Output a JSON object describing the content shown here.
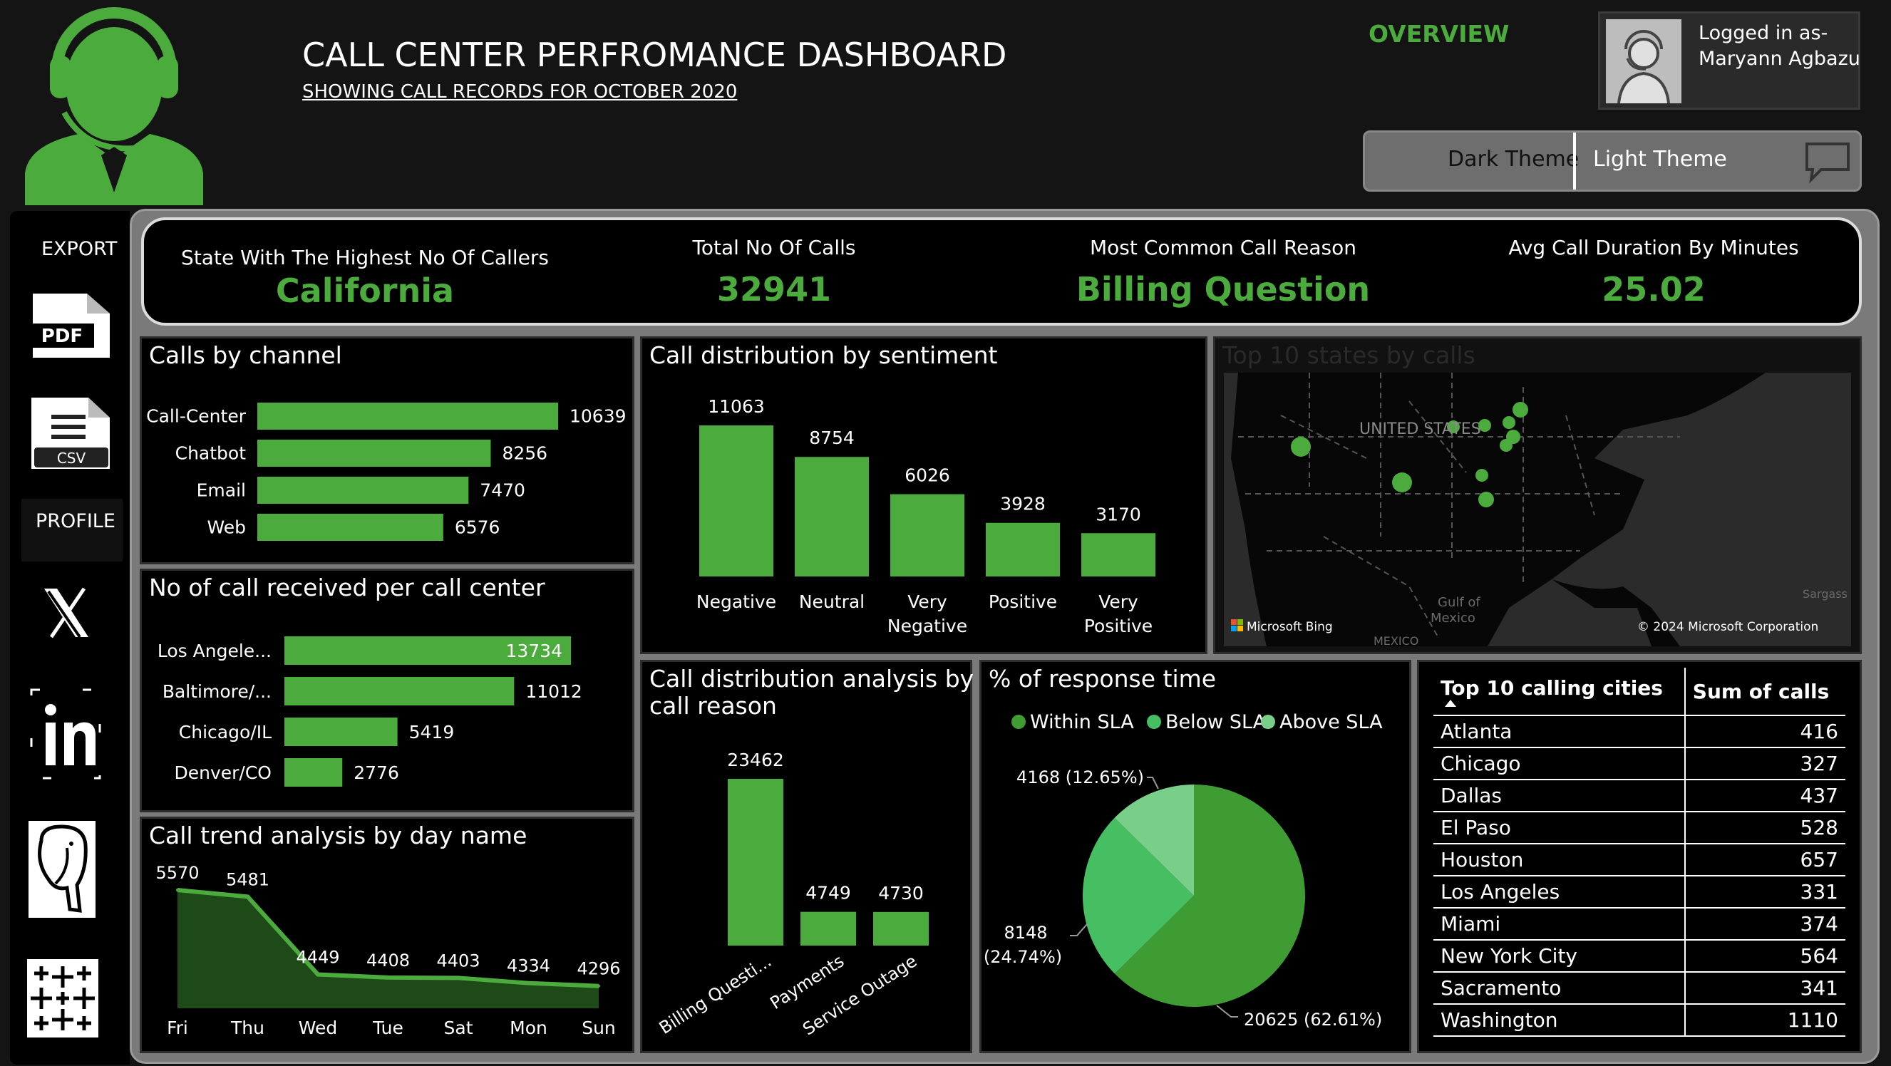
{
  "header": {
    "title": "CALL CENTER PERFROMANCE DASHBOARD",
    "subtitle": "SHOWING CALL RECORDS FOR OCTOBER 2020",
    "nav_overview": "OVERVIEW",
    "user_line1": "Logged in as-",
    "user_line2": "Maryann  Agbazu",
    "theme_dark": "Dark Theme",
    "theme_light": "Light Theme"
  },
  "sidebar": {
    "export_label": "EXPORT",
    "pdf_label": "PDF",
    "csv_label": "CSV",
    "profile_label": "PROFILE"
  },
  "kpis": {
    "state_label": "State With The Highest No Of Callers",
    "state_value": "California",
    "calls_label": "Total No Of Calls",
    "calls_value": "32941",
    "reason_label": "Most Common Call Reason",
    "reason_value": "Billing Question",
    "duration_label": "Avg Call Duration By Minutes",
    "duration_value": "25.02"
  },
  "panels": {
    "channel_title": "Calls by channel",
    "center_title": "No of call received per call center",
    "trend_title": "Call trend analysis by day name",
    "sentiment_title": "Call distribution by sentiment",
    "reason_title_1": "Call distribution analysis by",
    "reason_title_2": "call reason",
    "response_title": "% of response time",
    "map_title": "Top 10 states by calls",
    "map_country": "UNITED STATES",
    "map_gulf_1": "Gulf of",
    "map_gulf_2": "Mexico",
    "map_mexico": "MEXICO",
    "map_sargasso": "Sargass",
    "map_bing": "Microsoft Bing",
    "map_copyright": "© 2024 Microsoft Corporation",
    "cities_col1": "Top 10 calling cities",
    "cities_col2": "Sum of calls"
  },
  "colors": {
    "accent": "#4bab3c",
    "panel_bg": "#000000",
    "page_bg": "#141414",
    "pie_within": "#3e9c33",
    "pie_below": "#46bf62",
    "pie_above": "#79cf8a"
  },
  "chart_data": [
    {
      "type": "bar",
      "orientation": "horizontal",
      "title": "Calls by channel",
      "categories": [
        "Call-Center",
        "Chatbot",
        "Email",
        "Web"
      ],
      "values": [
        10639,
        8256,
        7470,
        6576
      ],
      "labels": [
        "10639",
        "8256",
        "7470",
        "6576"
      ]
    },
    {
      "type": "bar",
      "orientation": "horizontal",
      "title": "No of call received per call center",
      "categories": [
        "Los Angele...",
        "Baltimore/...",
        "Chicago/IL",
        "Denver/CO"
      ],
      "values": [
        13734,
        11012,
        5419,
        2776
      ],
      "labels": [
        "13734",
        "11012",
        "5419",
        "2776"
      ]
    },
    {
      "type": "area",
      "title": "Call trend analysis by day name",
      "categories": [
        "Fri",
        "Thu",
        "Wed",
        "Tue",
        "Sat",
        "Mon",
        "Sun"
      ],
      "values": [
        5570,
        5481,
        4449,
        4408,
        4403,
        4334,
        4296
      ],
      "labels": [
        "5570",
        "5481",
        "4449",
        "4408",
        "4403",
        "4334",
        "4296"
      ]
    },
    {
      "type": "bar",
      "orientation": "vertical",
      "title": "Call distribution by sentiment",
      "categories": [
        [
          "Negative"
        ],
        [
          "Neutral"
        ],
        [
          "Very",
          "Negative"
        ],
        [
          "Positive"
        ],
        [
          "Very",
          "Positive"
        ]
      ],
      "values": [
        11063,
        8754,
        6026,
        3928,
        3170
      ],
      "labels": [
        "11063",
        "8754",
        "6026",
        "3928",
        "3170"
      ]
    },
    {
      "type": "bar",
      "orientation": "vertical",
      "title": "Call distribution analysis by call reason",
      "categories": [
        "Billing Questi...",
        "Payments",
        "Service Outage"
      ],
      "values": [
        23462,
        4749,
        4730
      ],
      "labels": [
        "23462",
        "4749",
        "4730"
      ]
    },
    {
      "type": "pie",
      "title": "% of response time",
      "legend": [
        "Within SLA",
        "Below SLA",
        "Above SLA"
      ],
      "values": [
        20625,
        8148,
        4168
      ],
      "labels": [
        "20625 (62.61%)",
        "8148",
        "(24.74%)",
        "4168 (12.65%)"
      ]
    },
    {
      "type": "table",
      "columns": [
        "Top 10 calling cities",
        "Sum of calls"
      ],
      "rows": [
        [
          "Atlanta",
          "416"
        ],
        [
          "Chicago",
          "327"
        ],
        [
          "Dallas",
          "437"
        ],
        [
          "El Paso",
          "528"
        ],
        [
          "Houston",
          "657"
        ],
        [
          "Los Angeles",
          "331"
        ],
        [
          "Miami",
          "374"
        ],
        [
          "New York City",
          "564"
        ],
        [
          "Sacramento",
          "341"
        ],
        [
          "Washington",
          "1110"
        ]
      ]
    }
  ]
}
